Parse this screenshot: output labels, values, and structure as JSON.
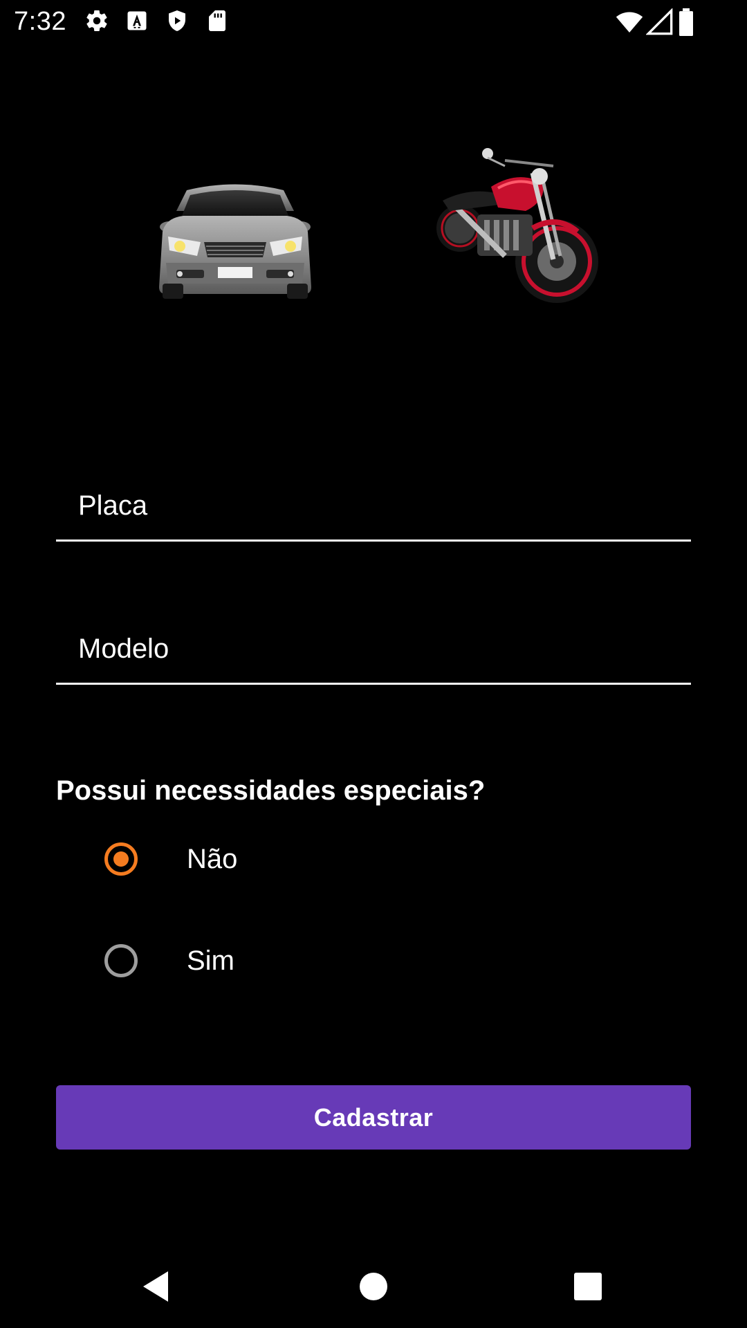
{
  "status_bar": {
    "time": "7:32",
    "icons_left": [
      "settings-icon",
      "font-a-icon",
      "shield-play-icon",
      "sd-card-icon"
    ],
    "icons_right": [
      "wifi-icon",
      "cell-signal-icon",
      "battery-icon"
    ]
  },
  "vehicles": {
    "car": {
      "icon": "car-image",
      "color": "#8C8C8C"
    },
    "motorcycle": {
      "icon": "motorcycle-image",
      "color": "#C8102E"
    }
  },
  "form": {
    "placa": {
      "placeholder": "Placa",
      "value": ""
    },
    "modelo": {
      "placeholder": "Modelo",
      "value": ""
    },
    "question": "Possui necessidades especiais?",
    "options": [
      {
        "label": "Não",
        "checked": true
      },
      {
        "label": "Sim",
        "checked": false
      }
    ],
    "submit_label": "Cadastrar"
  },
  "colors": {
    "background": "#000000",
    "accent_radio": "#F57C20",
    "button": "#673AB7",
    "text": "#FFFFFF"
  },
  "nav_bar": {
    "icons": [
      "back-icon",
      "home-icon",
      "recents-icon"
    ]
  }
}
